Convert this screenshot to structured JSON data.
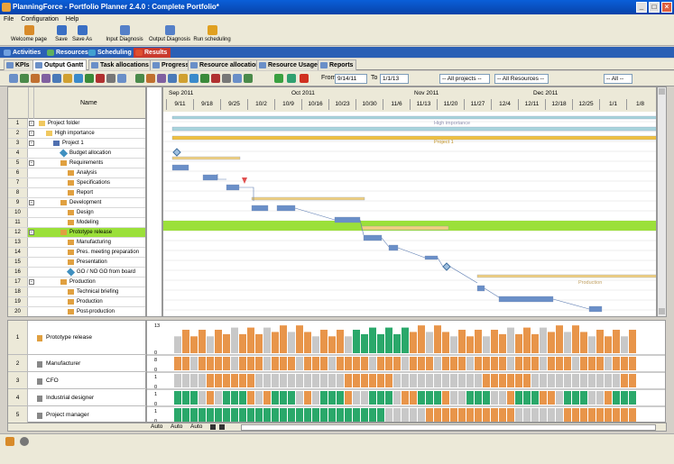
{
  "window": {
    "title": "PlanningForce - Portfolio Planner 2.4.0 : Complete Portfolio*"
  },
  "menu": [
    "File",
    "Configuration",
    "Help"
  ],
  "toolbar": [
    {
      "label": "Welcome page",
      "color": "#d88b2a"
    },
    {
      "label": "Save",
      "color": "#3a6fc4"
    },
    {
      "label": "Save As",
      "color": "#3a6fc4"
    },
    {
      "label": "Input Diagnosis",
      "color": "#5580c8"
    },
    {
      "label": "Output Diagnosis",
      "color": "#5580c8"
    },
    {
      "label": "Run scheduling",
      "color": "#e0a020"
    }
  ],
  "nav_tabs": [
    "Activities",
    "Resources",
    "Scheduling",
    "Results"
  ],
  "sub_tabs": [
    "KPIs",
    "Output Gantt",
    "Task allocations",
    "Progress",
    "Resource allocations",
    "Resource Usage",
    "Reports"
  ],
  "gantt_toolbar": {
    "from_label": "From",
    "from_value": "9/14/11",
    "to_label": "To",
    "to_value": "1/1/13",
    "projects": "-- All projects --",
    "resources": "-- All Resources --",
    "all": "-- All --"
  },
  "grid": {
    "name_header": "Name",
    "rows": [
      {
        "n": "1",
        "name": "Project folder",
        "depth": 0,
        "exp": "−",
        "icon": "folder"
      },
      {
        "n": "2",
        "name": "High importance",
        "depth": 1,
        "exp": "−",
        "icon": "folder"
      },
      {
        "n": "3",
        "name": "Project 1",
        "depth": 2,
        "exp": "−",
        "icon": "project"
      },
      {
        "n": "4",
        "name": "Budget allocation",
        "depth": 3,
        "exp": "",
        "icon": "milestone"
      },
      {
        "n": "5",
        "name": "Requirements",
        "depth": 3,
        "exp": "−",
        "icon": "task"
      },
      {
        "n": "6",
        "name": "Analysis",
        "depth": 4,
        "exp": "",
        "icon": "task"
      },
      {
        "n": "7",
        "name": "Specifications",
        "depth": 4,
        "exp": "",
        "icon": "task"
      },
      {
        "n": "8",
        "name": "Report",
        "depth": 4,
        "exp": "",
        "icon": "task"
      },
      {
        "n": "9",
        "name": "Development",
        "depth": 3,
        "exp": "−",
        "icon": "task"
      },
      {
        "n": "10",
        "name": "Design",
        "depth": 4,
        "exp": "",
        "icon": "task"
      },
      {
        "n": "11",
        "name": "Modeling",
        "depth": 4,
        "exp": "",
        "icon": "task"
      },
      {
        "n": "12",
        "name": "Prototype release",
        "depth": 3,
        "exp": "−",
        "icon": "task",
        "sel": true
      },
      {
        "n": "13",
        "name": "Manufacturing",
        "depth": 4,
        "exp": "",
        "icon": "task"
      },
      {
        "n": "14",
        "name": "Pres. meeting preparation",
        "depth": 4,
        "exp": "",
        "icon": "task"
      },
      {
        "n": "15",
        "name": "Presentation",
        "depth": 4,
        "exp": "",
        "icon": "task"
      },
      {
        "n": "16",
        "name": "GO / NO GO from board",
        "depth": 4,
        "exp": "",
        "icon": "milestone"
      },
      {
        "n": "17",
        "name": "Production",
        "depth": 3,
        "exp": "−",
        "icon": "task"
      },
      {
        "n": "18",
        "name": "Technical briefing",
        "depth": 4,
        "exp": "",
        "icon": "task"
      },
      {
        "n": "19",
        "name": "Production",
        "depth": 4,
        "exp": "",
        "icon": "task"
      },
      {
        "n": "20",
        "name": "Post-production",
        "depth": 4,
        "exp": "",
        "icon": "task"
      }
    ]
  },
  "timeline": {
    "months": [
      "Sep 2011",
      "Oct 2011",
      "Nov 2011",
      "Dec 2011"
    ],
    "weeks": [
      "9/11",
      "9/18",
      "9/25",
      "10/2",
      "10/9",
      "10/16",
      "10/23",
      "10/30",
      "11/6",
      "11/13",
      "11/20",
      "11/27",
      "12/4",
      "12/11",
      "12/18",
      "12/25",
      "1/1",
      "1/8"
    ]
  },
  "bar_labels": {
    "high": "High importance",
    "project": "Project 1",
    "production": "Production"
  },
  "resources": [
    {
      "n": "1",
      "name": "Prototype release",
      "top": "13",
      "bottom": "0"
    },
    {
      "n": "2",
      "name": "Manufacturer",
      "top": "8",
      "bottom": "0"
    },
    {
      "n": "3",
      "name": "CFO",
      "top": "1",
      "bottom": "0"
    },
    {
      "n": "4",
      "name": "Industrial designer",
      "top": "1",
      "bottom": "0"
    },
    {
      "n": "5",
      "name": "Project manager",
      "top": "1",
      "bottom": "0"
    }
  ],
  "bottom_buttons": [
    "Auto",
    "Auto",
    "Auto"
  ],
  "colors": {
    "accent": "#2a5fb5",
    "selection": "#9be03a",
    "orange": "#e8954a",
    "green": "#2aa86a",
    "gray": "#c8c8c8"
  }
}
